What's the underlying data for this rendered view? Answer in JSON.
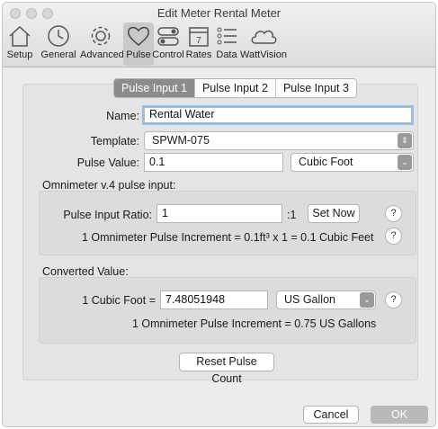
{
  "window": {
    "title": "Edit Meter Rental Meter"
  },
  "toolbar": {
    "items": [
      {
        "label": "Setup",
        "icon": "house-icon"
      },
      {
        "label": "General",
        "icon": "clock-icon"
      },
      {
        "label": "Advanced",
        "icon": "gear-icon"
      },
      {
        "label": "Pulse",
        "icon": "heart-icon"
      },
      {
        "label": "Control",
        "icon": "toggle-icon"
      },
      {
        "label": "Rates",
        "icon": "calendar-icon"
      },
      {
        "label": "Data",
        "icon": "list-icon"
      },
      {
        "label": "WattVision",
        "icon": "cloud-icon"
      }
    ],
    "calendar_day": "7"
  },
  "tabs": [
    "Pulse Input 1",
    "Pulse Input 2",
    "Pulse Input 3"
  ],
  "form": {
    "name_label": "Name:",
    "name_value": "Rental Water",
    "template_label": "Template:",
    "template_value": "SPWM-075",
    "pulse_value_label": "Pulse Value:",
    "pulse_value": "0.1",
    "pulse_unit": "Cubic Foot",
    "section_omnimeter": "Omnimeter v.4 pulse input:",
    "ratio_label": "Pulse Input Ratio:",
    "ratio_value": "1",
    "ratio_suffix": ":1",
    "set_now": "Set Now",
    "increment_text": "1 Omnimeter Pulse Increment = 0.1ft³ x 1 = 0.1 Cubic Feet",
    "section_converted": "Converted Value:",
    "convert_label": "1 Cubic Foot =",
    "convert_value": "7.48051948",
    "convert_unit": "US Gallon",
    "converted_text": "1 Omnimeter Pulse Increment = 0.75 US Gallons",
    "reset_button": "Reset Pulse Count",
    "help": "?"
  },
  "footer": {
    "cancel": "Cancel",
    "ok": "OK"
  }
}
